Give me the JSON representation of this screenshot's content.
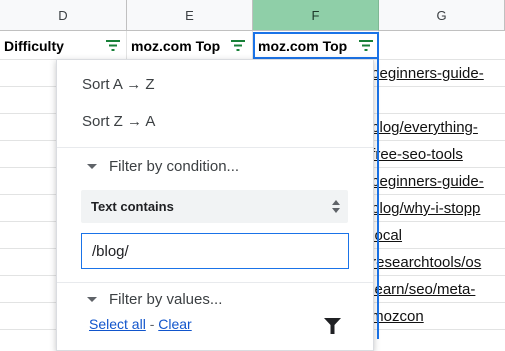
{
  "columns": {
    "d": "D",
    "e": "E",
    "f": "F",
    "g": "G"
  },
  "header_cells": {
    "difficulty": "Difficulty",
    "moz_top_e": "moz.com Top",
    "moz_top_f": "moz.com Top"
  },
  "column_g_links": [
    "/beginners-guide-",
    "/",
    "/blog/everything-",
    "/free-seo-tools",
    "/beginners-guide-",
    "/blog/why-i-stopp",
    "/local",
    "/researchtools/os",
    "/learn/seo/meta-",
    "/mozcon"
  ],
  "filter_menu": {
    "sort_az": "Sort A → Z",
    "sort_za": "Sort Z → A",
    "filter_by_condition": "Filter by condition...",
    "condition": "Text contains",
    "condition_value": "/blog/",
    "filter_by_values": "Filter by values...",
    "select_all": "Select all",
    "separator": "-",
    "clear": "Clear"
  },
  "icons": {
    "filter": "filter-lines-icon",
    "funnel": "funnel-icon",
    "select_arrows": "updown-arrows-icon",
    "collapse": "triangle-down-icon"
  },
  "colors": {
    "accent": "#1a73e8",
    "filter_icon": "#188038",
    "selected_column": "#8fcfa8",
    "link": "#1155cc"
  }
}
